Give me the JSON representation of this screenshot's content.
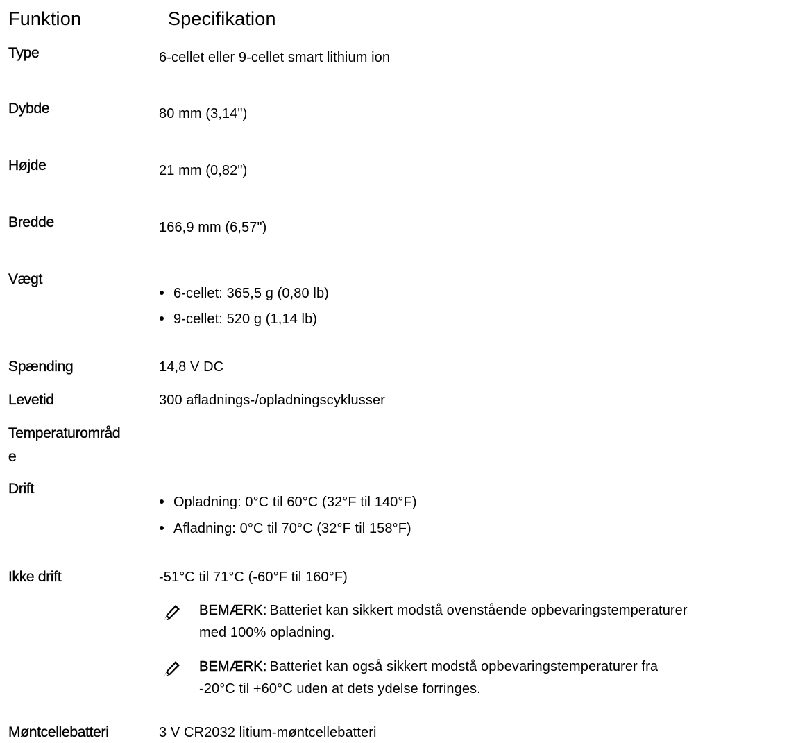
{
  "table": {
    "header": {
      "col1": "Funktion",
      "col2": "Specifikation"
    },
    "rows": {
      "type": {
        "label": "Type",
        "value": "6-cellet eller 9-cellet smart lithium ion"
      },
      "dybde": {
        "label": "Dybde",
        "value": "80 mm (3,14\")"
      },
      "hojde": {
        "label": "Højde",
        "value": "21 mm (0,82\")"
      },
      "bredde": {
        "label": "Bredde",
        "value": "166,9 mm (6,57\")"
      },
      "vaegt": {
        "label": "Vægt",
        "bullets": [
          "6-cellet: 365,5 g (0,80 lb)",
          "9-cellet: 520 g (1,14 lb)"
        ]
      },
      "spaending": {
        "label": "Spænding",
        "value": "14,8 V DC"
      },
      "levetid": {
        "label": "Levetid",
        "value": "300 afladnings-/opladningscyklusser"
      },
      "temperatur": {
        "label_line1": "Temperaturområd",
        "label_line2": "e"
      },
      "drift": {
        "label": "Drift",
        "bullets": [
          "Opladning: 0°C til 60°C (32°F til 140°F)",
          "Afladning: 0°C til 70°C (32°F til 158°F)"
        ]
      },
      "ikke_drift": {
        "label": "Ikke drift",
        "value": "-51°C til 71°C (-60°F til 160°F)",
        "notes": [
          {
            "key": "BEMÆRK:",
            "line1": "Batteriet kan sikkert modstå ovenstående opbevaringstemperaturer",
            "line2": "med 100% opladning."
          },
          {
            "key": "BEMÆRK:",
            "line1": "Batteriet kan også sikkert modstå opbevaringstemperaturer fra",
            "line2": "-20°C til +60°C uden at dets ydelse forringes."
          }
        ]
      },
      "montcelle": {
        "label": "Møntcellebatteri",
        "value": "3 V CR2032 litium-møntcellebatteri"
      }
    }
  },
  "icons": {
    "note_icon": "pencil-note-icon"
  }
}
